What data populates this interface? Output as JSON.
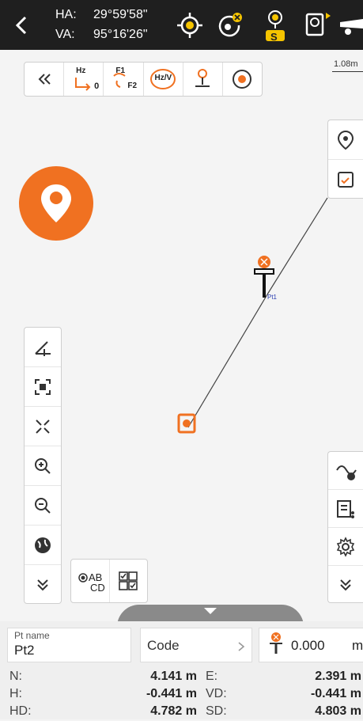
{
  "header": {
    "angles": {
      "ha_label": "HA:",
      "ha_value": "29°59'58\"",
      "va_label": "VA:",
      "va_value": "95°16'26\""
    },
    "station_badge": "S"
  },
  "toolbar": {
    "hz_label": "Hz",
    "hz_sub": "0",
    "f1_label": "F1",
    "f2_label": "F2",
    "hzv_label": "Hz/V"
  },
  "map": {
    "scale_text": "1.08m",
    "point_label": "Pt1"
  },
  "bottom_tools": {
    "label_ab": "AB",
    "label_cd": "CD"
  },
  "form": {
    "pt_name_label": "Pt name",
    "pt_name_value": "Pt2",
    "code_placeholder": "Code",
    "target_height": "0.000",
    "target_unit": "m"
  },
  "measurements": [
    {
      "left_label": "N:",
      "left_value": "4.141 m",
      "right_label": "E:",
      "right_value": "2.391 m"
    },
    {
      "left_label": "H:",
      "left_value": "-0.441 m",
      "right_label": "VD:",
      "right_value": "-0.441 m"
    },
    {
      "left_label": "HD:",
      "left_value": "4.782 m",
      "right_label": "SD:",
      "right_value": "4.803 m"
    }
  ],
  "colors": {
    "accent": "#f07121",
    "topbar": "#1f1f1f",
    "badge": "#f5c400"
  }
}
